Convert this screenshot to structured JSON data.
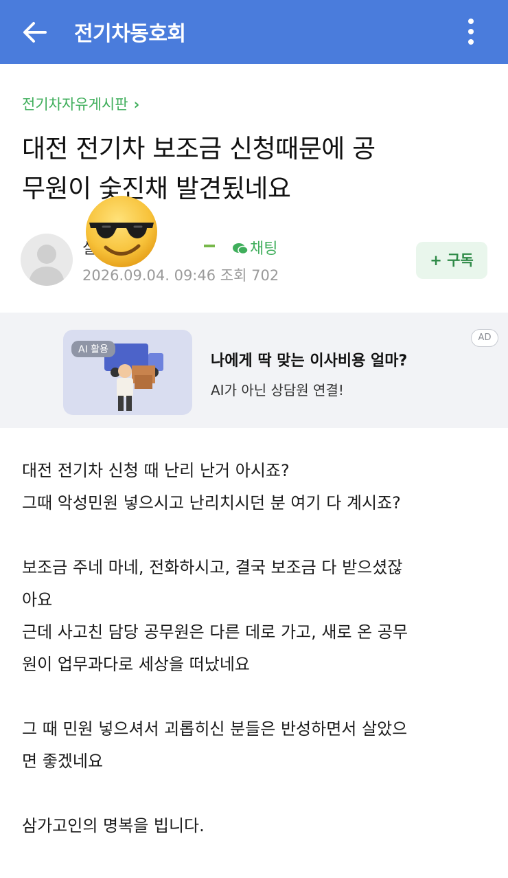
{
  "header": {
    "title": "전기차동호회",
    "background": "#4a7cdc",
    "back_icon": "arrow-left-icon",
    "menu_icon": "more-vertical-icon"
  },
  "post": {
    "board": "전기차자유게시판",
    "title_lines": [
      "대전 전기차 보조금 신청때문에 공",
      "무원이 숯진채 발견됬네요"
    ],
    "author": {
      "name_visible": "실        씨성남",
      "chat_label": "채팅",
      "date": "2026.09.04. 09:46",
      "views_label": "조회 702"
    },
    "subscribe_label": "+ 구독",
    "sticker": "sunglasses-emoji-icon"
  },
  "ad": {
    "pill": "AI 활용",
    "headline": "나에게 딱 맞는 이사비용 얼마?",
    "subtext": "AI가 아닌 상담원 연결!",
    "badge": "AD"
  },
  "body": {
    "lines": [
      "대전 전기차 신청 때 난리 난거 아시죠?",
      "그때 악성민원 넣으시고 난리치시던 분 여기 다 계시죠?",
      "",
      "보조금 주네 마네, 전화하시고, 결국 보조금 다 받으셨잖",
      "아요",
      "근데 사고친 담당 공무원은 다른 데로 가고, 새로 온 공무",
      "원이 업무과다로 세상을 떠났네요",
      "",
      "그 때 민원 넣으셔서 괴롭히신 분들은 반성하면서 살았으",
      "면 좋겠네요",
      "",
      "삼가고인의 명복을 빕니다."
    ]
  },
  "colors": {
    "accent_green": "#3fae5b",
    "ad_background": "#f2f3f6"
  }
}
